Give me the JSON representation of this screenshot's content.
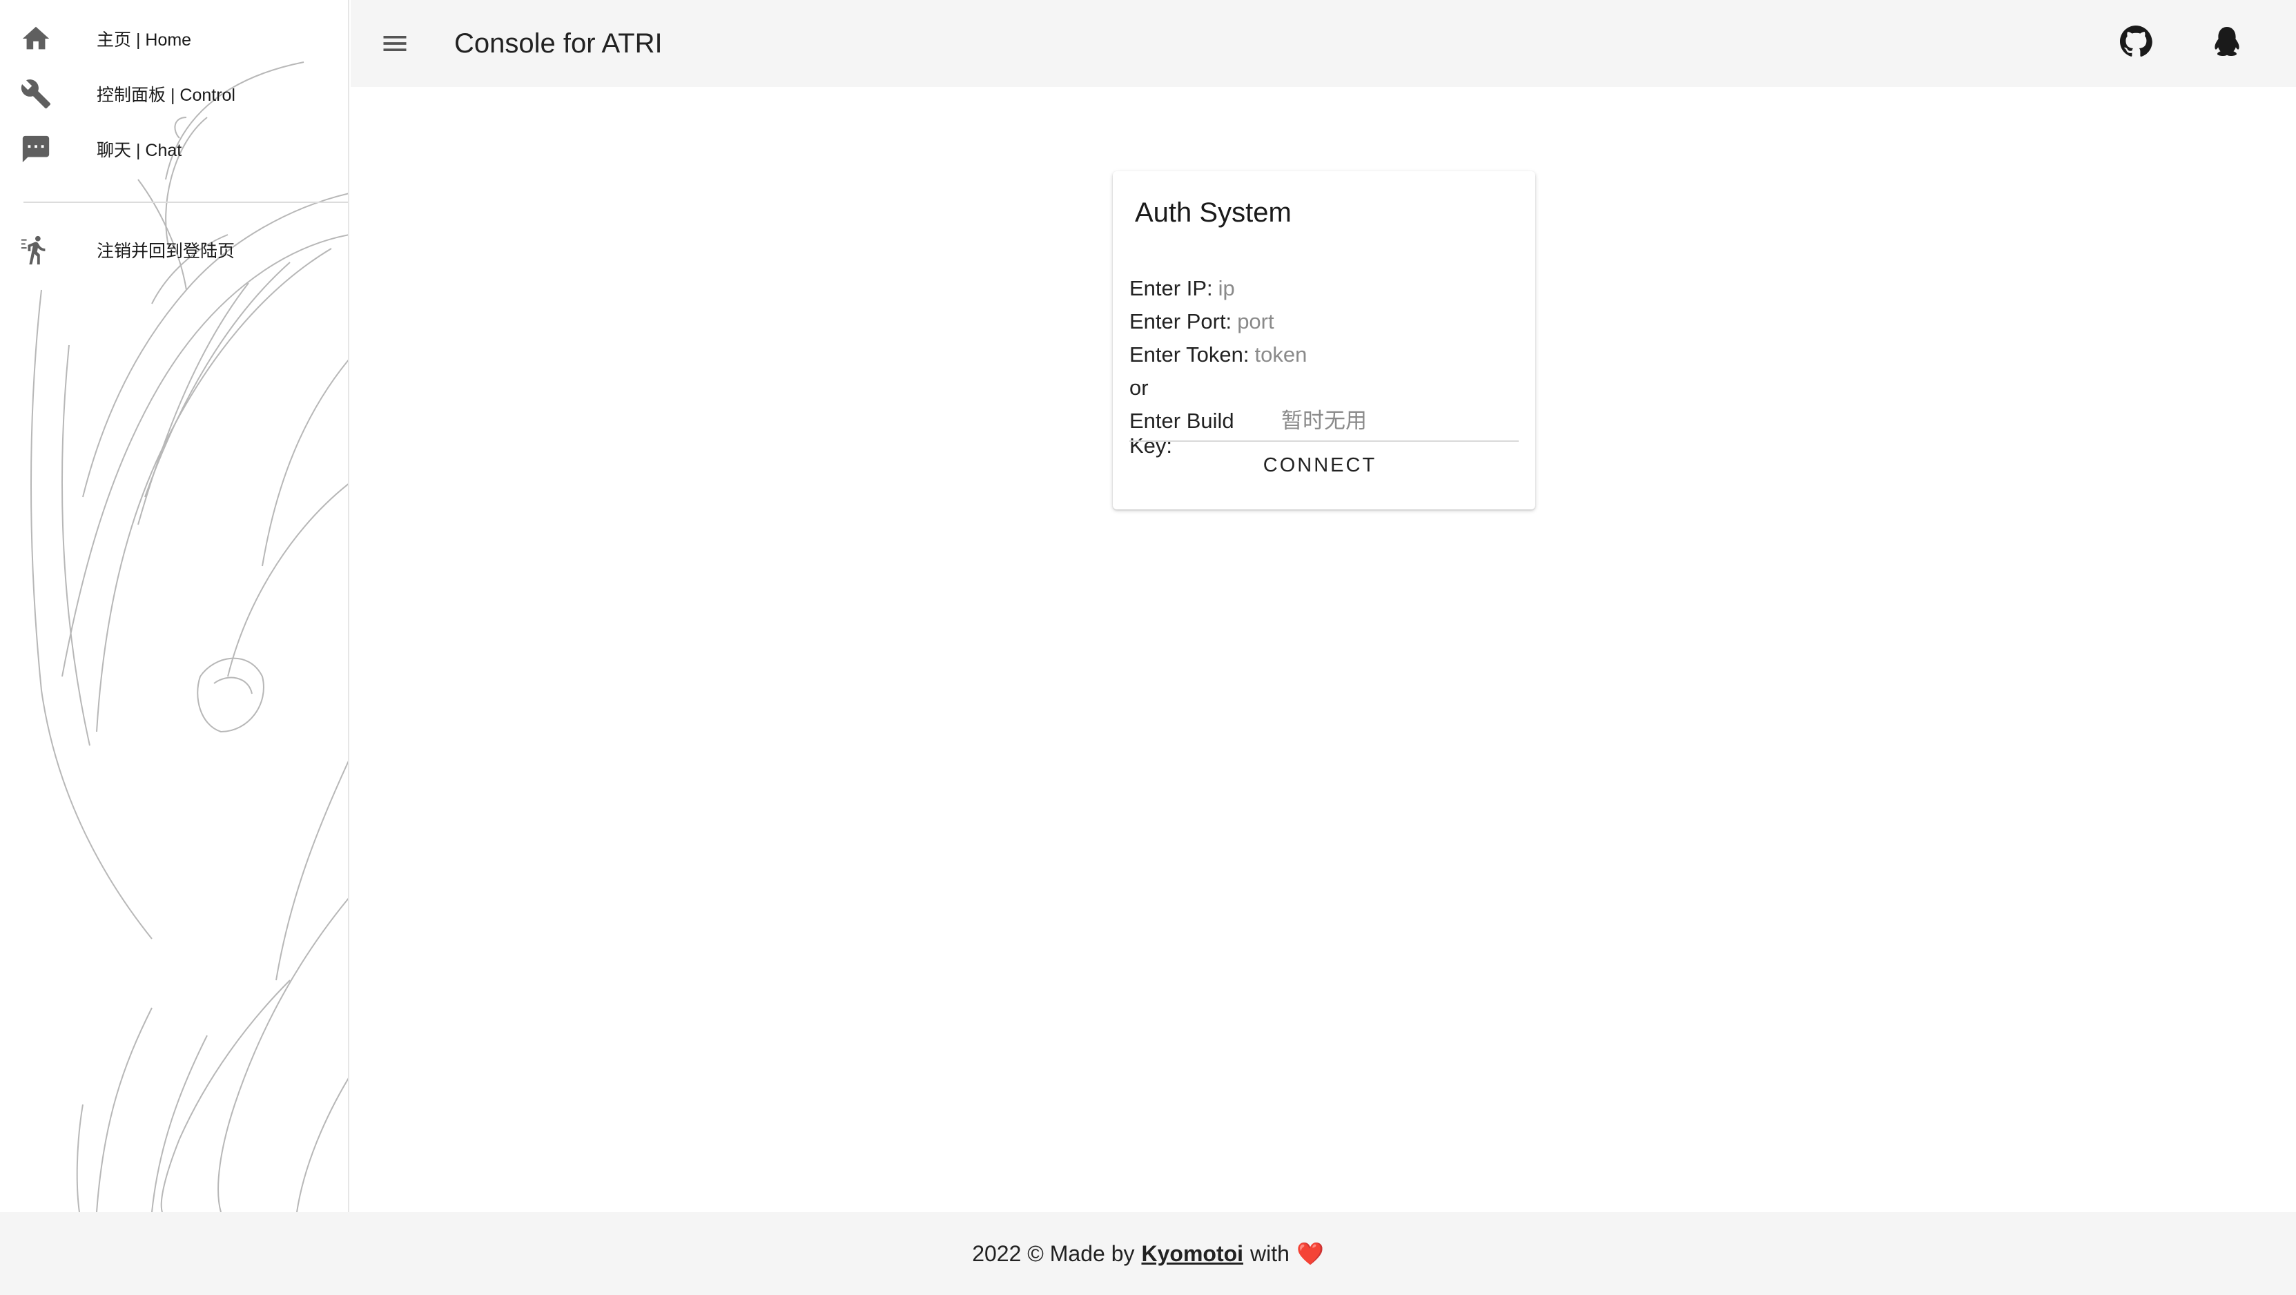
{
  "header": {
    "title": "Console for ATRI"
  },
  "sidebar": {
    "items": [
      {
        "label": "主页 | Home",
        "icon": "home-icon"
      },
      {
        "label": "控制面板 | Control",
        "icon": "wrench-icon"
      },
      {
        "label": "聊天 | Chat",
        "icon": "chat-icon"
      },
      {
        "label": "注销并回到登陆页",
        "icon": "logout-run-icon"
      }
    ]
  },
  "card": {
    "title": "Auth System",
    "ip_label": "Enter IP:",
    "ip_placeholder": "ip",
    "port_label": "Enter Port:",
    "port_placeholder": "port",
    "token_label": "Enter Token:",
    "token_placeholder": "token",
    "or_text": "or",
    "build_key_label": "Enter Build Key:",
    "build_key_placeholder": "暂时无用",
    "connect_label": "CONNECT"
  },
  "footer": {
    "prefix": "2022 © Made by",
    "author": "Kyomotoi",
    "suffix": "with",
    "heart": "❤️"
  },
  "colors": {
    "header_bg": "#f5f5f5",
    "footer_bg": "#f5f5f5",
    "heart": "#e02424"
  }
}
